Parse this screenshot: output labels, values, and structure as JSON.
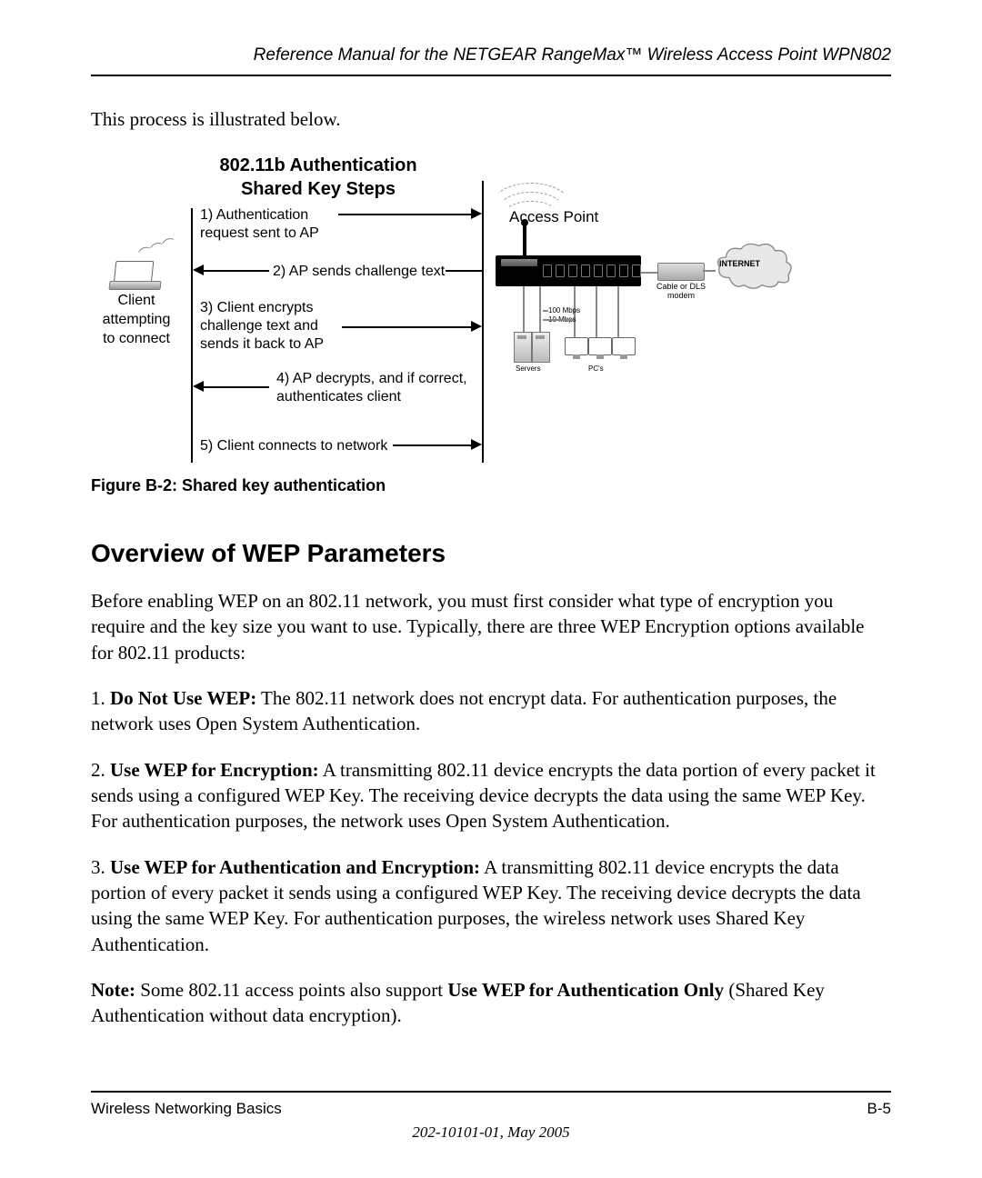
{
  "header": {
    "title": "Reference Manual for the NETGEAR RangeMax™ Wireless Access Point WPN802"
  },
  "intro": "This process is illustrated below.",
  "diagram": {
    "title_line1": "802.11b Authentication",
    "title_line2": "Shared Key Steps",
    "client_line1": "Client",
    "client_line2": "attempting",
    "client_line3": "to connect",
    "ap_label": "Access Point",
    "step1_line1": "1) Authentication",
    "step1_line2": "request sent to AP",
    "step2": "2) AP sends challenge text",
    "step3_line1": "3) Client encrypts",
    "step3_line2": "challenge text and",
    "step3_line3": "sends it back to AP",
    "step4_line1": "4) AP decrypts, and if correct,",
    "step4_line2": "authenticates client",
    "step5": "5) Client connects to network",
    "modem_label": "Cable or DLS modem",
    "internet_label": "INTERNET",
    "net_100": "100 Mbps",
    "net_10": "10 Mbps",
    "servers_label": "Servers",
    "pcs_label": "PC's"
  },
  "figure_caption": "Figure B-2:  Shared key authentication",
  "section_heading": "Overview of WEP Parameters",
  "para1": "Before enabling WEP on an 802.11 network, you must first consider what type of encryption you require and the key size you want to use. Typically, there are three WEP Encryption options available for 802.11 products:",
  "opt1_bold": "Do Not Use WEP:",
  "opt1_text": " The 802.11 network does not encrypt data. For authentication purposes, the network uses Open System Authentication.",
  "opt2_bold": "Use WEP for Encryption:",
  "opt2_text": " A transmitting 802.11 device encrypts the data portion of every packet it sends using a configured WEP Key. The receiving device decrypts the data using the same WEP Key. For authentication purposes, the network uses Open System Authentication.",
  "opt3_bold": "Use WEP for Authentication and Encryption:",
  "opt3_text": " A transmitting 802.11 device encrypts the data portion of every packet it sends using a configured WEP Key. The receiving device decrypts the data using the same WEP Key. For authentication purposes, the wireless network uses Shared Key Authentication.",
  "note_bold": "Note:",
  "note_text1": " Some 802.11 access points also support ",
  "note_bold2": "Use WEP for Authentication Only",
  "note_text2": " (Shared Key Authentication without data encryption).",
  "footer": {
    "left": "Wireless Networking Basics",
    "right": "B-5",
    "docid": "202-10101-01, May 2005"
  }
}
